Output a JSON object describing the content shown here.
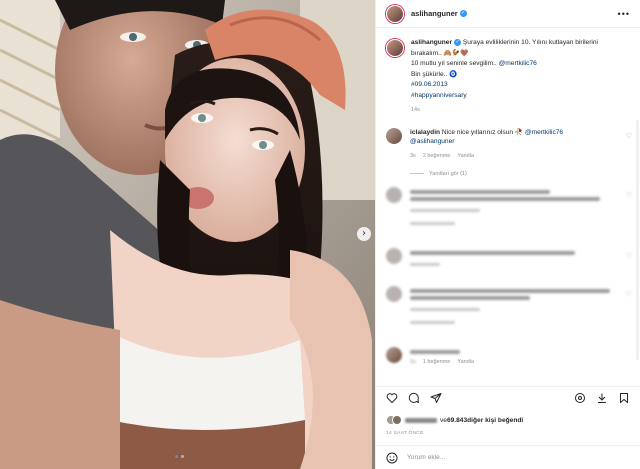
{
  "post": {
    "username": "aslihanguner",
    "more_icon": "more-icon"
  },
  "caption": {
    "username": "aslihanguner",
    "line1": "Şuraya evliliklerinin 10. Yılını kutlayan birilerini bırakalım.. 🙈🐓🤎",
    "line2": "10 mutlu yıl seninle sevgilim.. ",
    "mention": "@mertkilic76",
    "line3": "Bin şükürle.. 🧿",
    "date_tag": "#09.06.2013",
    "hashtag": "#happyanniversary",
    "time": "14s"
  },
  "comment1": {
    "username": "iclalaydin",
    "text": "Nice nice yıllarınız olsun 🥀 ",
    "mention1": "@mertkilic76",
    "mention2": "@aslihanguner",
    "time": "3s",
    "likes": "2 beğenme",
    "reply": "Yanıtla",
    "view_replies": "Yanıtları gör (1)"
  },
  "blurred_comments": {
    "meta_sample": "Yanıtla",
    "last_likes": "1 beğenme",
    "last_reply": "Yanıtla"
  },
  "likes": {
    "count": "69.843",
    "prefix": "ve ",
    "suffix": " diğer kişi beğendi"
  },
  "time_ago": "14 SAAT ÖNCE",
  "add_comment": {
    "placeholder": "Yorum ekle..."
  },
  "colors": {
    "link": "#00376b",
    "verified": "#3797f0",
    "muted": "#8e8e8e"
  }
}
